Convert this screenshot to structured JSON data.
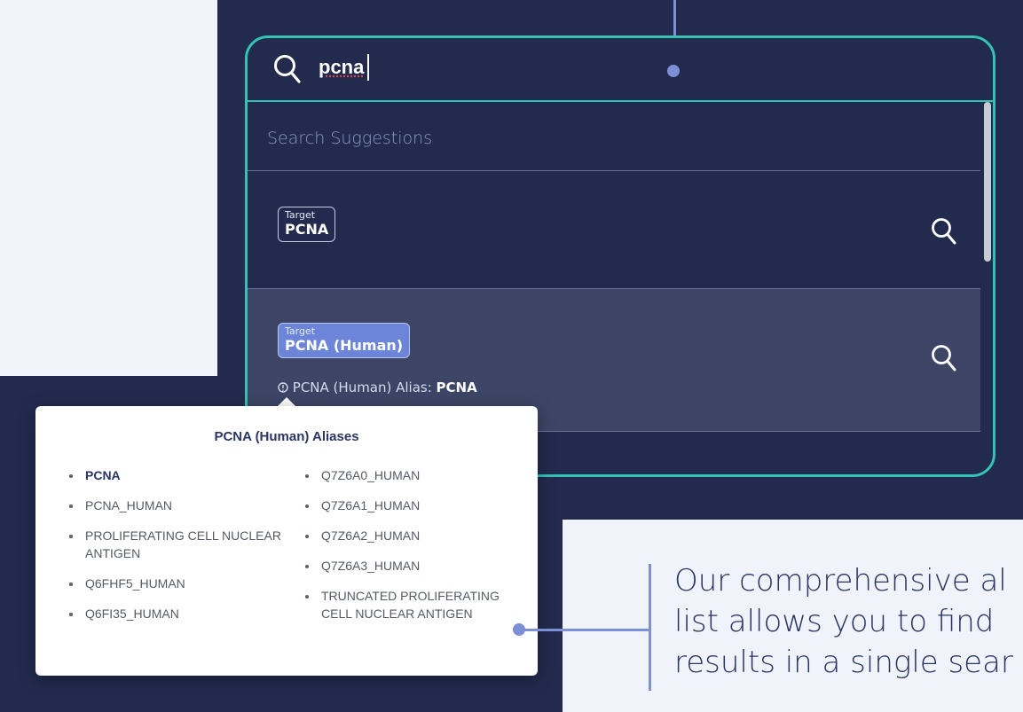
{
  "search": {
    "query": "pcna",
    "suggestions_label": "Search Suggestions"
  },
  "suggestions": [
    {
      "type": "Target",
      "name": "PCNA"
    },
    {
      "type": "Target",
      "name": "PCNA (Human)",
      "alias_prefix": "PCNA (Human) Alias: ",
      "alias_value": "PCNA"
    }
  ],
  "aliases_popover": {
    "title": "PCNA (Human) Aliases",
    "left_column": [
      "PCNA",
      "PCNA_HUMAN",
      "PROLIFERATING CELL NUCLEAR ANTIGEN",
      "Q6FHF5_HUMAN",
      "Q6FI35_HUMAN"
    ],
    "right_column": [
      "Q7Z6A0_HUMAN",
      "Q7Z6A1_HUMAN",
      "Q7Z6A2_HUMAN",
      "Q7Z6A3_HUMAN",
      "TRUNCATED PROLIFERATING CELL NUCLEAR ANTIGEN"
    ]
  },
  "callout": {
    "lines": [
      "Our comprehensive al",
      "list allows you to find",
      "results in a single sear"
    ]
  },
  "colors": {
    "panel": "#222b4e",
    "accent_teal": "#35c2b5",
    "badge_selected": "#6c85d8",
    "callout_line": "#7d8fd6",
    "heading_text": "#2a3563"
  },
  "icons": {
    "search": "search-icon",
    "info": "info-icon"
  }
}
